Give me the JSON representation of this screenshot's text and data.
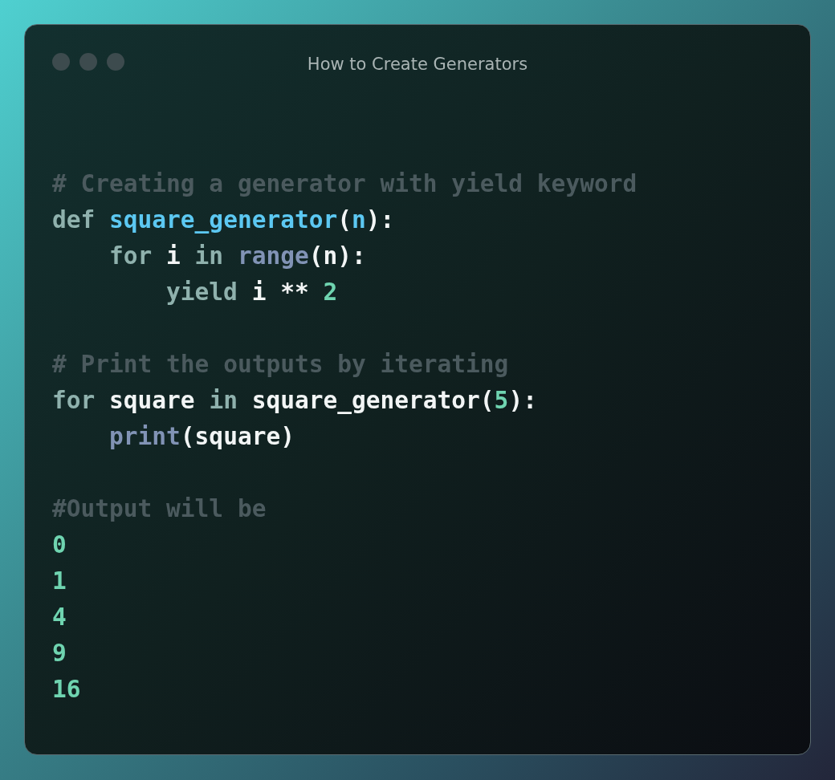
{
  "window": {
    "title": "How to Create Generators"
  },
  "code_blocks": [
    [
      {
        "tokens": [
          {
            "text": "# Creating a generator with yield keyword",
            "kind": "comment"
          }
        ]
      },
      {
        "tokens": [
          {
            "text": "def ",
            "kind": "keyword"
          },
          {
            "text": "square_generator",
            "kind": "function"
          },
          {
            "text": "(",
            "kind": "plain"
          },
          {
            "text": "n",
            "kind": "function"
          },
          {
            "text": "):",
            "kind": "plain"
          }
        ],
        "children": [
          {
            "tokens": [
              {
                "text": "for ",
                "kind": "keyword"
              },
              {
                "text": "i ",
                "kind": "plain"
              },
              {
                "text": "in ",
                "kind": "keyword"
              },
              {
                "text": "range",
                "kind": "builtin"
              },
              {
                "text": "(n):",
                "kind": "plain"
              }
            ],
            "children": [
              {
                "tokens": [
                  {
                    "text": "yield ",
                    "kind": "keyword"
                  },
                  {
                    "text": "i ** ",
                    "kind": "plain"
                  },
                  {
                    "text": "2",
                    "kind": "number"
                  }
                ]
              }
            ]
          }
        ]
      }
    ],
    [
      {
        "tokens": [
          {
            "text": "# Print the outputs by iterating",
            "kind": "comment"
          }
        ]
      },
      {
        "tokens": [
          {
            "text": "for ",
            "kind": "keyword"
          },
          {
            "text": "square ",
            "kind": "plain"
          },
          {
            "text": "in ",
            "kind": "keyword"
          },
          {
            "text": "square_generator(",
            "kind": "plain"
          },
          {
            "text": "5",
            "kind": "number"
          },
          {
            "text": "):",
            "kind": "plain"
          }
        ],
        "children": [
          {
            "tokens": [
              {
                "text": "print",
                "kind": "builtin"
              },
              {
                "text": "(square)",
                "kind": "plain"
              }
            ]
          }
        ]
      }
    ],
    [
      {
        "tokens": [
          {
            "text": "#Output will be",
            "kind": "comment"
          }
        ]
      },
      {
        "tokens": [
          {
            "text": "0",
            "kind": "number"
          }
        ]
      },
      {
        "tokens": [
          {
            "text": "1",
            "kind": "number"
          }
        ]
      },
      {
        "tokens": [
          {
            "text": "4",
            "kind": "number"
          }
        ]
      },
      {
        "tokens": [
          {
            "text": "9",
            "kind": "number"
          }
        ]
      },
      {
        "tokens": [
          {
            "text": "16",
            "kind": "number"
          }
        ]
      }
    ]
  ]
}
